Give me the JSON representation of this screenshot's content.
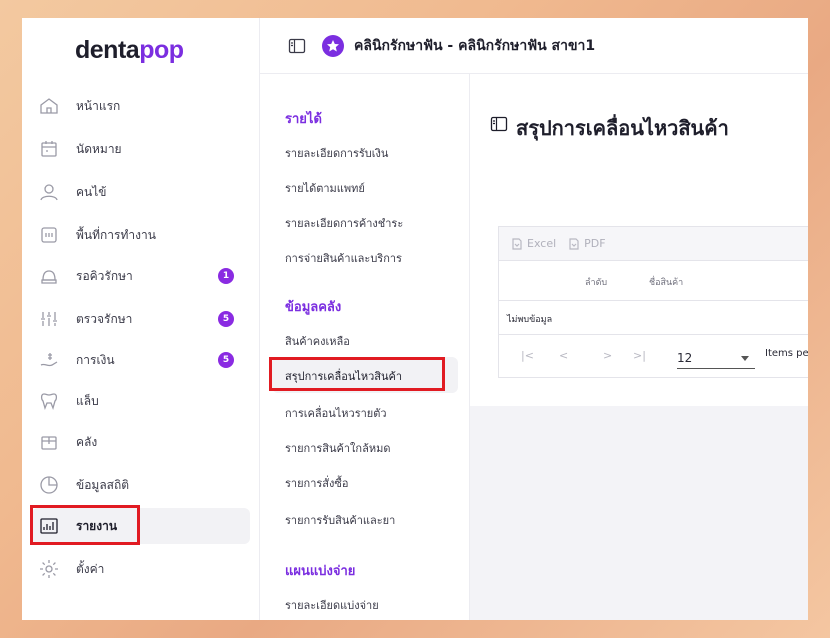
{
  "app": {
    "logo_main": "denta",
    "logo_accent": "pop"
  },
  "header": {
    "clinic_title": "คลินิกรักษาฟัน - คลินิกรักษาฟัน สาขา1"
  },
  "sidebar": {
    "items": [
      {
        "label": "หน้าแรก",
        "icon": "home-icon"
      },
      {
        "label": "นัดหมาย",
        "icon": "calendar-icon"
      },
      {
        "label": "คนไข้",
        "icon": "user-icon"
      },
      {
        "label": "พื้นที่การทำงาน",
        "icon": "workspace-icon"
      },
      {
        "label": "รอคิวรักษา",
        "icon": "dental-chair-icon",
        "badge": "1"
      },
      {
        "label": "ตรวจรักษา",
        "icon": "tools-icon",
        "badge": "5"
      },
      {
        "label": "การเงิน",
        "icon": "money-icon",
        "badge": "5"
      },
      {
        "label": "แล็บ",
        "icon": "tooth-icon"
      },
      {
        "label": "คลัง",
        "icon": "box-icon"
      },
      {
        "label": "ข้อมูลสถิติ",
        "icon": "stats-icon"
      },
      {
        "label": "รายงาน",
        "icon": "report-chart-icon",
        "active": true
      },
      {
        "label": "ตั้งค่า",
        "icon": "gear-icon"
      }
    ]
  },
  "submenu": {
    "income_heading": "รายได้",
    "income_items": [
      "รายละเอียดการรับเงิน",
      "รายได้ตามแพทย์",
      "รายละเอียดการค้างชำระ",
      "การจ่ายสินค้าและบริการ"
    ],
    "stock_heading": "ข้อมูลคลัง",
    "stock_items": [
      "สินค้าคงเหลือ",
      "สรุปการเคลื่อนไหวสินค้า",
      "การเคลื่อนไหวรายตัว",
      "รายการสินค้าใกล้หมด",
      "รายการสั่งซื้อ",
      "รายการรับสินค้าและยา"
    ],
    "share_heading": "แผนแบ่งจ่าย",
    "share_items": [
      "รายละเอียดแบ่งจ่าย"
    ]
  },
  "main": {
    "page_title": "สรุปการเคลื่อนไหวสินค้า",
    "toolbar": {
      "excel_label": "Excel",
      "pdf_label": "PDF"
    },
    "columns": [
      "ลำดับ",
      "ชื่อสินค้า"
    ],
    "empty_text": "ไม่พบข้อมูล",
    "pager": {
      "first": "|<",
      "prev": "<",
      "next": ">",
      "last": ">|",
      "page_size": "12",
      "items_per_page": "Items pe"
    }
  },
  "colors": {
    "accent": "#7b2ee0",
    "badge": "#8a2be2",
    "highlight_box": "#e11b22"
  }
}
